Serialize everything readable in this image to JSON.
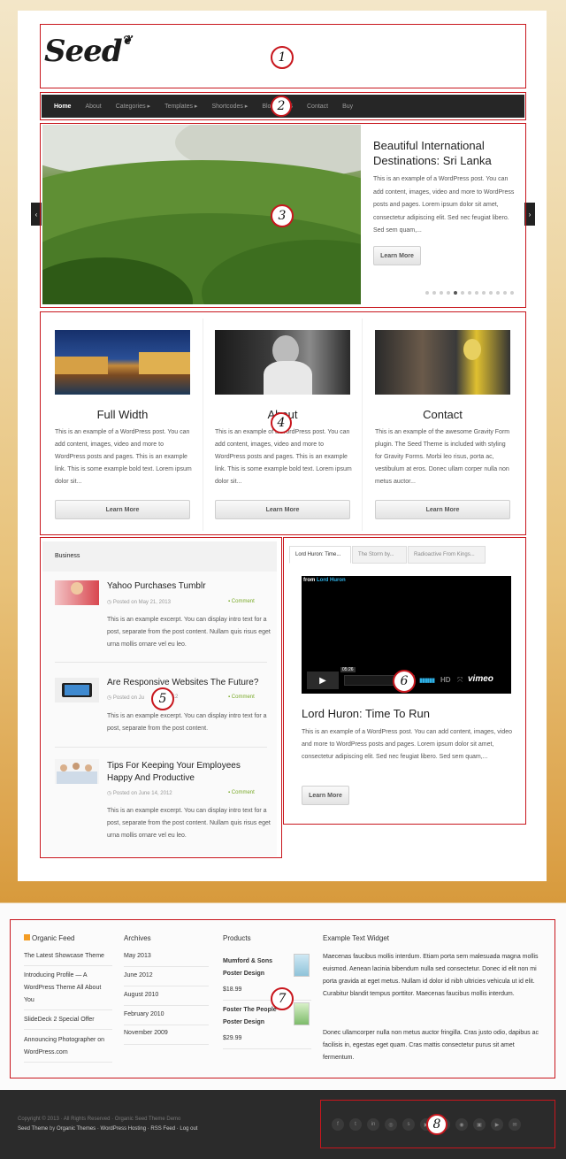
{
  "site": {
    "logo_text": "Seed",
    "leaf_icon": "leaf-icon"
  },
  "nav": {
    "items": [
      {
        "label": "Home",
        "active": true
      },
      {
        "label": "About"
      },
      {
        "label": "Categories ▸"
      },
      {
        "label": "Templates ▸"
      },
      {
        "label": "Shortcodes ▸"
      },
      {
        "label": "Blog"
      },
      {
        "label": "S"
      },
      {
        "label": "Contact"
      },
      {
        "label": "Buy"
      }
    ]
  },
  "slider": {
    "title": "Beautiful International Destinations: Sri Lanka",
    "text": "This is an example of a WordPress post. You can add content, images, video and more to WordPress posts and pages. Lorem ipsum dolor sit amet, consectetur adipiscing elit. Sed nec feugiat libero. Sed sem quam,...",
    "button": "Learn More",
    "prev": "‹",
    "next": "›",
    "dot_count": 13,
    "active_dot": 4
  },
  "columns": [
    {
      "title": "Full Width",
      "text": "This is an example of a WordPress post. You can add content, images, video and more to WordPress posts and pages. This is an example link. This is some example bold text. Lorem ipsum dolor sit...",
      "button": "Learn More"
    },
    {
      "title": "About",
      "text": "This is an example of a WordPress post. You can add content, images, video and more to WordPress posts and pages. This is an example link. This is some example bold text. Lorem ipsum dolor sit...",
      "button": "Learn More"
    },
    {
      "title": "Contact",
      "text": "This is an example of the awesome Gravity Form plugin. The Seed Theme is included with styling for Gravity Forms. Morbi leo risus, porta ac, vestibulum at eros. Donec ullam corper nulla non metus auctor...",
      "button": "Learn More"
    }
  ],
  "business": {
    "heading": "Business",
    "posts": [
      {
        "title": "Yahoo Purchases Tumblr",
        "date": "Posted on May 21, 2013",
        "comment": "Comment",
        "excerpt": "This is an example excerpt. You can display intro text for a post, separate from the post content. Nullam quis risus eget urna mollis ornare vel eu leo."
      },
      {
        "title": "Are Responsive Websites The Future?",
        "date": "Posted on Ju",
        "date_tail": "2012",
        "comment": "Comment",
        "excerpt": "This is an example excerpt. You can display intro text for a post, separate from the post content."
      },
      {
        "title": "Tips For Keeping Your Employees Happy And Productive",
        "date": "Posted on June 14, 2012",
        "comment": "Comment",
        "excerpt": "This is an example excerpt. You can display intro text for a post, separate from the post content. Nullam quis risus eget urna mollis ornare vel eu leo."
      }
    ]
  },
  "video": {
    "tabs": [
      "Lord Huron: Time...",
      "The Storm by...",
      "Radioactive From Kings..."
    ],
    "from_label": "from",
    "from_name": "Lord Huron",
    "duration": "05:26",
    "player_brand": "vimeo",
    "hd_label": "HD",
    "title": "Lord Huron: Time To Run",
    "text": "This is an example of a WordPress post. You can add content, images, video and more to WordPress posts and pages. Lorem ipsum dolor sit amet, consectetur adipiscing elit. Sed nec feugiat libero. Sed sem quam,...",
    "button": "Learn More"
  },
  "footer": {
    "organic_feed": {
      "heading": "Organic Feed",
      "items": [
        "The Latest Showcase Theme",
        "Introducing Profile — A WordPress Theme All About You",
        "SlideDeck 2 Special Offer",
        "Announcing Photographer on WordPress.com"
      ]
    },
    "archives": {
      "heading": "Archives",
      "items": [
        "May 2013",
        "June 2012",
        "August 2010",
        "February 2010",
        "November 2009"
      ]
    },
    "products": {
      "heading": "Products",
      "items": [
        {
          "name": "Mumford & Sons Poster Design",
          "price": "$18.99"
        },
        {
          "name": "Foster The People Poster Design",
          "price": "$29.99"
        }
      ]
    },
    "text_widget": {
      "heading": "Example Text Widget",
      "p1": "Maecenas faucibus mollis interdum. Etiam porta sem malesuada magna mollis euismod. Aenean lacinia bibendum nulla sed consectetur. Donec id elit non mi porta gravida at eget metus. Nullam id dolor id nibh ultricies vehicula ut id elit. Curabitur blandit tempus porttitor. Maecenas faucibus mollis interdum.",
      "p2": "Donec ullamcorper nulla non metus auctor fringilla. Cras justo odio, dapibus ac facilisis in, egestas eget quam. Cras mattis consectetur purus sit amet fermentum."
    }
  },
  "bottom": {
    "copyright": "Copyright © 2013 · All Rights Reserved · Organic Seed Theme Demo",
    "credits_pre": "Seed Theme",
    "credits_by": "by",
    "credits_links": "Organic Themes · WordPress Hosting · RSS Feed · Log out",
    "social": [
      "f",
      "t",
      "in",
      "◎",
      "s",
      "▶",
      "p",
      "◉",
      "▣",
      "▶",
      "✉"
    ]
  },
  "markers": [
    "1",
    "2",
    "3",
    "4",
    "5",
    "6",
    "7",
    "8"
  ]
}
